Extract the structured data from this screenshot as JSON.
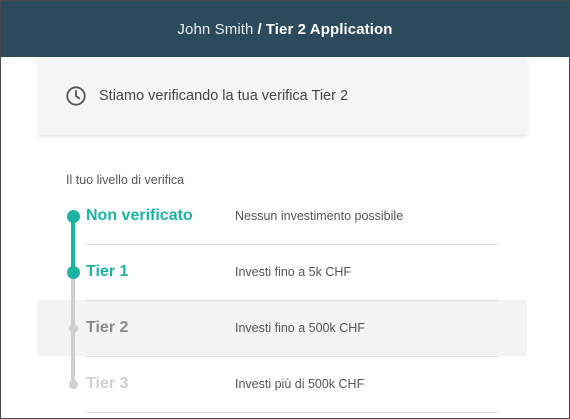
{
  "header": {
    "user_name": "John Smith",
    "separator": "/",
    "page_title": "Tier 2 Application",
    "background_color": "#2b4a5c"
  },
  "status": {
    "icon": "clock-icon",
    "text": "Stiamo verificando la tua verifica Tier 2"
  },
  "verification": {
    "section_label": "Il tuo livello di verifica",
    "accent_color": "#1bb3a1",
    "tiers": [
      {
        "name": "Non verificato",
        "description": "Nessun investimento possibile",
        "state": "completed",
        "color": "#1bb3a1"
      },
      {
        "name": "Tier 1",
        "description": "Investi fino a 5k CHF",
        "state": "current",
        "color": "#1bb3a1"
      },
      {
        "name": "Tier 2",
        "description": "Investi fino a 500k CHF",
        "state": "in-review",
        "color": "#8a8a8a"
      },
      {
        "name": "Tier 3",
        "description": "Investi più di 500k CHF",
        "state": "locked",
        "color": "#cfcfcf"
      }
    ]
  }
}
